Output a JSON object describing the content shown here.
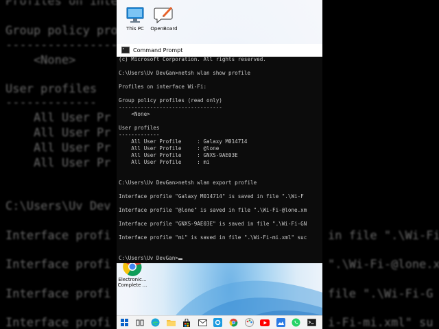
{
  "background_lines": [
    "Profiles on inte",
    "Group policy pro",
    "-----------------",
    "    <None>",
    "User profiles",
    "-------------",
    "    All User Pr",
    "    All User Pr",
    "    All User Pr",
    "    All User Pr",
    "C:\\Users\\Uv Dev",
    "Interface profi",
    "Interface profi",
    "Interface profi",
    "Interface profi",
    "in file \".\\Wi-Fi-",
    "\".\\Wi-Fi-@lone.x",
    "file \".\\Wi-Fi-G",
    "i-Fi-mi.xml\" su"
  ],
  "desktop": {
    "icons": [
      {
        "name": "this-pc",
        "label": "This PC"
      },
      {
        "name": "openboard",
        "label": "OpenBoard"
      },
      {
        "name": "chrome",
        "label": "Electronic... Complete ..."
      }
    ]
  },
  "cmd": {
    "title": "Command Prompt",
    "lines": [
      "(c) Microsoft Corporation. All rights reserved.",
      "",
      "C:\\Users\\Uv DevGan>netsh wlan show profile",
      "",
      "Profiles on interface Wi-Fi:",
      "",
      "Group policy profiles (read only)",
      "---------------------------------",
      "    <None>",
      "",
      "User profiles",
      "-------------",
      "    All User Profile     : Galaxy M014714",
      "    All User Profile     : @lone",
      "    All User Profile     : GNXS-9AE03E",
      "    All User Profile     : mi",
      "",
      "",
      "C:\\Users\\Uv DevGan>netsh wlan export profile",
      "",
      "Interface profile \"Galaxy M014714\" is saved in file \".\\Wi-F",
      "",
      "Interface profile \"@lone\" is saved in file \".\\Wi-Fi-@lone.xm",
      "",
      "Interface profile \"GNXS-9AE03E\" is saved in file \".\\Wi-Fi-GN",
      "",
      "Interface profile \"mi\" is saved in file \".\\Wi-Fi-mi.xml\" suc",
      "",
      "",
      "C:\\Users\\Uv DevGan>"
    ]
  },
  "taskbar": {
    "items": [
      "start-icon",
      "task-view-icon",
      "edge-icon",
      "file-explorer-icon",
      "store-icon",
      "mail-icon",
      "network-icon",
      "chrome-icon",
      "paint-icon",
      "youtube-icon",
      "photos-icon",
      "whatsapp-icon",
      "cmd-icon"
    ]
  },
  "colors": {
    "console_bg": "#0c0c0c",
    "console_text": "#cccccc",
    "taskbar_bg": "#f3f3f3"
  }
}
